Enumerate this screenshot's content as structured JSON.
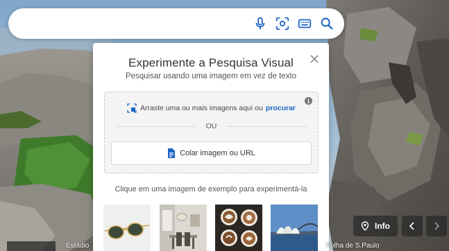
{
  "search": {
    "value": "",
    "placeholder": "",
    "icons": [
      "microphone-icon",
      "visual-search-icon",
      "keyboard-icon",
      "search-icon"
    ]
  },
  "dialog": {
    "title": "Experimente a Pesquisa Visual",
    "subtitle": "Pesquisar usando uma imagem em vez de texto",
    "drag_text": "Arraste uma ou mais imagens aqui ou",
    "browse_link": "procurar",
    "or_text": "OU",
    "paste_label": "Colar imagem ou URL",
    "examples_label": "Clique em uma imagem de exemplo para experimentá-la",
    "examples": [
      "sunglasses",
      "dining-room",
      "latte-art",
      "sydney-opera-house"
    ]
  },
  "controls": {
    "info_label": "Info"
  },
  "captions": {
    "left": "Estádio",
    "right": "Folha de S.Paulo"
  },
  "colors": {
    "accent": "#1c64c4",
    "overlay_button": "#282828"
  }
}
